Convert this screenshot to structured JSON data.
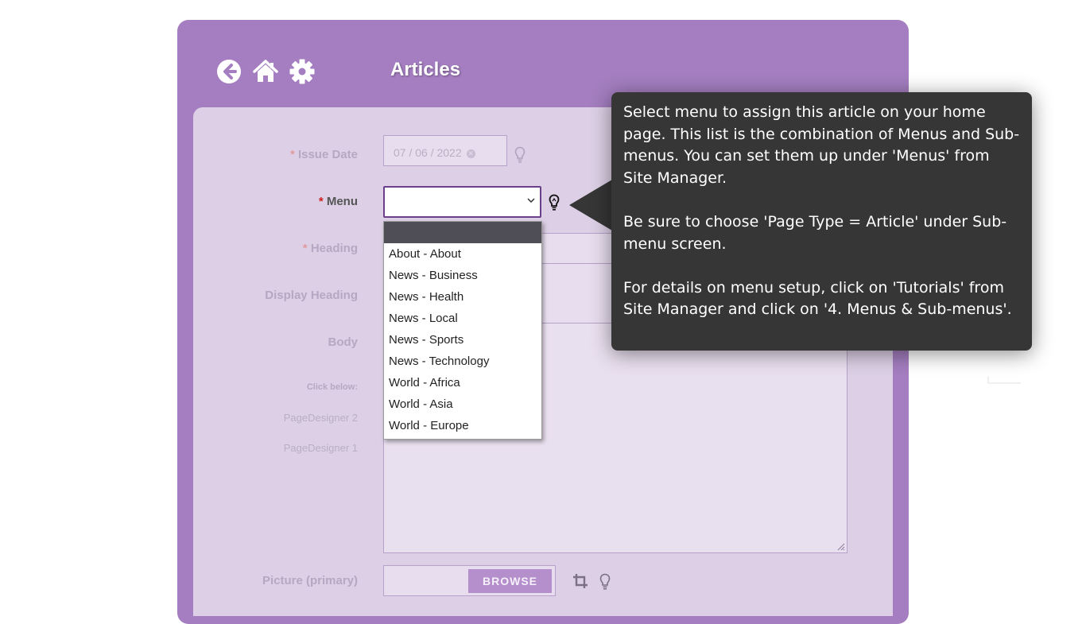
{
  "header": {
    "title": "Articles"
  },
  "nav": {
    "back_icon": "arrow-left-circle-icon",
    "home_icon": "home-icon",
    "settings_icon": "gear-icon"
  },
  "form": {
    "issue_date": {
      "label": "Issue Date",
      "required": "*",
      "value": "07 / 06 / 2022"
    },
    "menu": {
      "label": "Menu",
      "required": "*",
      "value": ""
    },
    "heading": {
      "label": "Heading",
      "required": "*"
    },
    "display_heading": {
      "label": "Display Heading"
    },
    "body": {
      "label": "Body"
    },
    "click_below": "Click below:",
    "page_designer_2": "PageDesigner 2",
    "page_designer_1": "PageDesigner 1",
    "picture": {
      "label": "Picture (primary)",
      "browse_label": "BROWSE"
    }
  },
  "dropdown": {
    "options": [
      "",
      "About - About",
      "News - Business",
      "News - Health",
      "News - Local",
      "News - Sports",
      "News - Technology",
      "World - Africa",
      "World - Asia",
      "World - Europe"
    ]
  },
  "tooltip": {
    "paragraph_1": "Select menu to assign this article on your home page. This list is the combination of Menus and Sub-menus. You can set them up under 'Menus' from Site Manager.",
    "paragraph_2": "Be sure to choose 'Page Type = Article' under Sub-menu screen.",
    "paragraph_3": "For details on menu setup, click on 'Tutorials' from Site Manager and click on '4. Menus & Sub-menus'."
  },
  "colors": {
    "panel": "#a47ec0",
    "form_bg": "#ddd0e6",
    "tooltip_bg": "#363636",
    "required": "#cc2222",
    "browse": "#b48fcb"
  }
}
